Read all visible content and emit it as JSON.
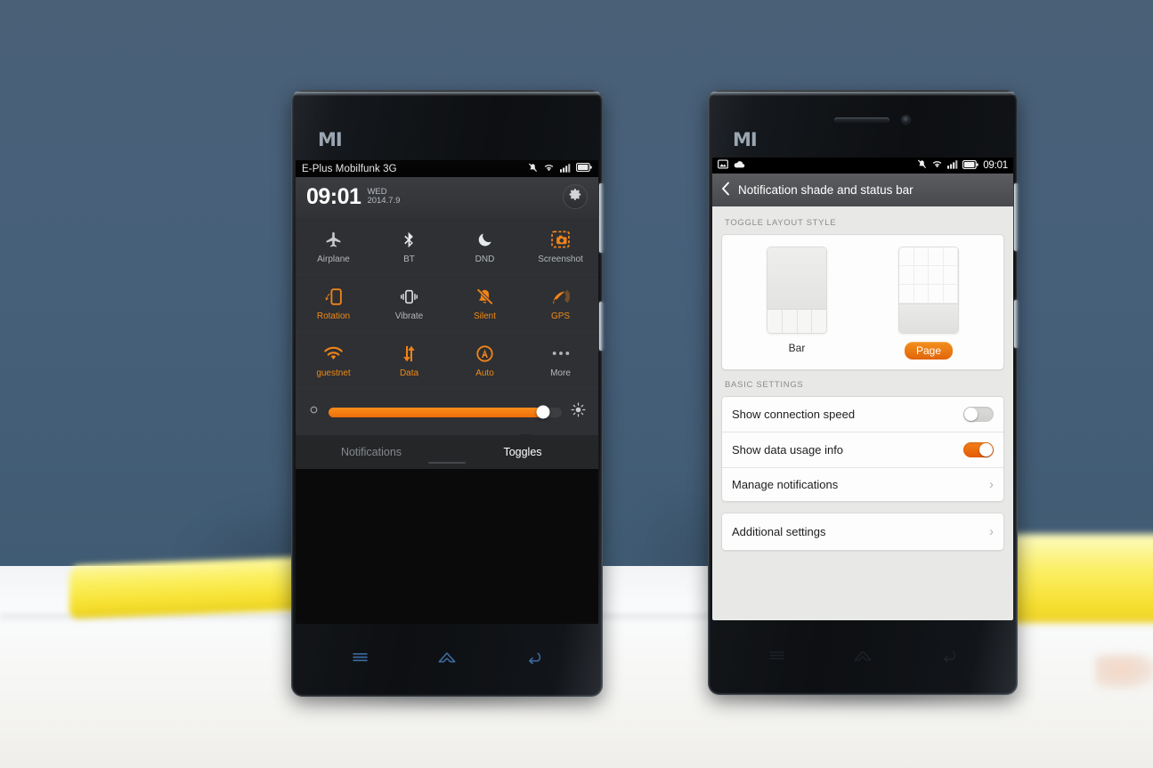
{
  "scene": {
    "background_color": "#44607a",
    "table_color": "#f6f6f4",
    "prop_color": "#f6e02f"
  },
  "left_phone": {
    "brand_logo": "MI",
    "status_bar": {
      "carrier": "E-Plus Mobilfunk 3G",
      "icons": [
        "silent-icon",
        "wifi-icon",
        "signal-icon",
        "battery-icon"
      ]
    },
    "shade": {
      "clock": "09:01",
      "day_of_week": "WED",
      "date": "2014.7.9",
      "settings_icon": "gear-icon"
    },
    "toggles": [
      {
        "label": "Airplane",
        "icon": "airplane-icon",
        "state": "off"
      },
      {
        "label": "BT",
        "icon": "bluetooth-icon",
        "state": "off"
      },
      {
        "label": "DND",
        "icon": "moon-icon",
        "state": "off"
      },
      {
        "label": "Screenshot",
        "icon": "screenshot-icon",
        "state": "action"
      },
      {
        "label": "Rotation",
        "icon": "rotation-icon",
        "state": "on"
      },
      {
        "label": "Vibrate",
        "icon": "vibrate-icon",
        "state": "off"
      },
      {
        "label": "Silent",
        "icon": "silent-bell-icon",
        "state": "on"
      },
      {
        "label": "GPS",
        "icon": "gps-icon",
        "state": "on"
      },
      {
        "label": "guestnet",
        "icon": "wifi-icon",
        "state": "on"
      },
      {
        "label": "Data",
        "icon": "data-icon",
        "state": "on"
      },
      {
        "label": "Auto",
        "icon": "auto-brightness-icon",
        "state": "on"
      },
      {
        "label": "More",
        "icon": "more-dots-icon",
        "state": "off"
      }
    ],
    "brightness": {
      "low_icon": "brightness-low-icon",
      "high_icon": "brightness-high-icon",
      "value_percent": 92,
      "fill_color": "#f07c10"
    },
    "tabs": [
      {
        "label": "Notifications",
        "active": false
      },
      {
        "label": "Toggles",
        "active": true
      }
    ],
    "nav_keys": [
      "menu-icon",
      "home-icon",
      "back-icon"
    ]
  },
  "right_phone": {
    "brand_logo": "MI",
    "status_bar": {
      "left_icons": [
        "screenshot-saved-icon",
        "cloud-upload-icon"
      ],
      "right_icons": [
        "silent-icon",
        "wifi-icon",
        "signal-icon",
        "battery-icon"
      ],
      "clock": "09:01"
    },
    "action_bar": {
      "back_icon": "back-chevron-icon",
      "title": "Notification shade and status bar"
    },
    "sections": [
      {
        "label": "TOGGLE LAYOUT STYLE",
        "options": [
          {
            "label": "Bar",
            "selected": false,
            "preview": "bar-layout-preview"
          },
          {
            "label": "Page",
            "selected": true,
            "preview": "page-layout-preview"
          }
        ]
      },
      {
        "label": "BASIC SETTINGS",
        "rows": [
          {
            "label": "Show connection speed",
            "control": "switch",
            "value": "off"
          },
          {
            "label": "Show data usage info",
            "control": "switch",
            "value": "on"
          },
          {
            "label": "Manage notifications",
            "control": "chevron",
            "chevron": "›"
          }
        ]
      }
    ],
    "extra_card": [
      {
        "label": "Additional settings",
        "control": "chevron",
        "chevron": "›"
      }
    ],
    "accent_color": "#e9660a",
    "nav_keys": [
      "menu-icon",
      "home-icon",
      "back-icon"
    ]
  }
}
